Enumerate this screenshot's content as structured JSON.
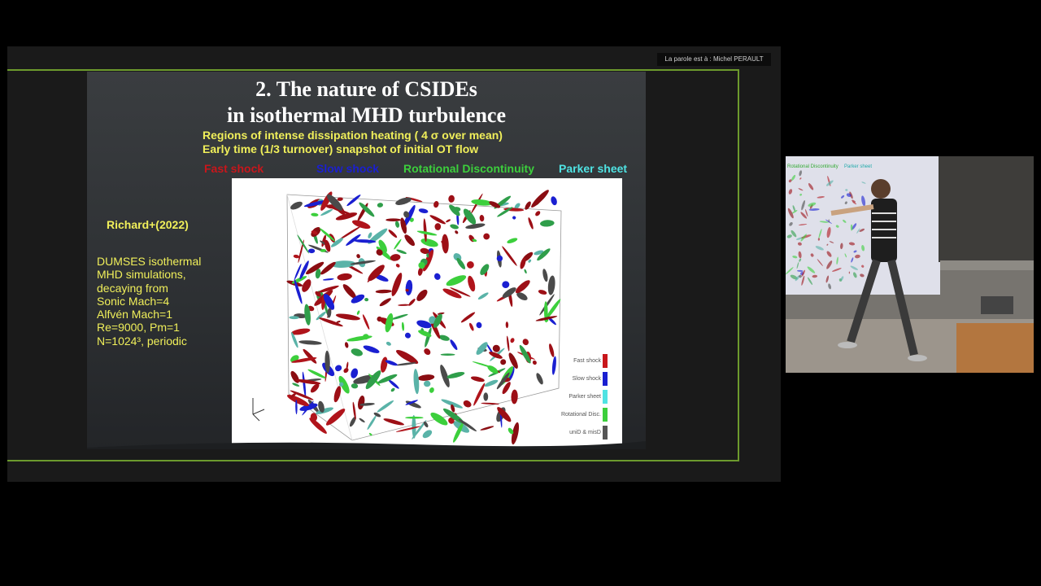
{
  "header": {
    "speaker_label": "La parole est à : Michel PERAULT"
  },
  "slide": {
    "title_line1": "2. The nature of CSIDEs",
    "title_line2": "in isothermal MHD turbulence",
    "subtitle_line1": "Regions of intense dissipation heating ( 4 σ over mean)",
    "subtitle_line2": "Early time (1/3 turnover) snapshot of initial OT flow",
    "legend": [
      {
        "label": "Fast shock",
        "color": "#c8161b"
      },
      {
        "label": "Slow shock",
        "color": "#1a1fd1"
      },
      {
        "label": "Rotational Discontinuity",
        "color": "#3ccf3c"
      },
      {
        "label": "Parker sheet",
        "color": "#4fe3e3"
      }
    ],
    "reference": "Richard+(2022)",
    "simulation_text": [
      "DUMSES isothermal",
      "MHD simulations,",
      "decaying from",
      "Sonic Mach=4",
      "Alfvén Mach=1",
      "Re=9000, Pm=1",
      "N=1024³, periodic"
    ],
    "figure_legend": [
      {
        "label": "Fast shock",
        "color": "#c8161b"
      },
      {
        "label": "Slow shock",
        "color": "#1a1fd1"
      },
      {
        "label": "Parker sheet",
        "color": "#4fe3e3"
      },
      {
        "label": "Rotational Disc.",
        "color": "#3ccf3c"
      },
      {
        "label": "uniD & misD",
        "color": "#555555"
      }
    ]
  },
  "video": {
    "overlay_text_left": "Rotational Discontinuity",
    "overlay_text_right": "Parker sheet"
  },
  "colors": {
    "accent_frame": "#6c9a2d",
    "slide_text_yellow": "#f0ef5a"
  }
}
